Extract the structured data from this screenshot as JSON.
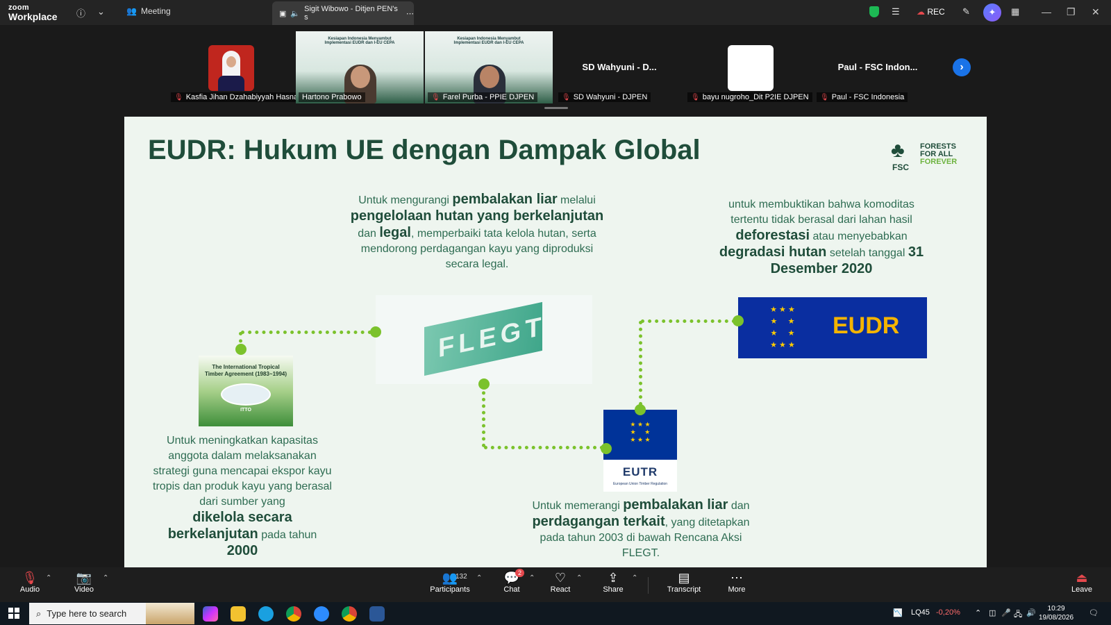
{
  "app": {
    "brand_top": "zoom",
    "brand_bottom": "Workplace",
    "meeting_label": "Meeting",
    "speaker_tab": "Sigit Wibowo - Ditjen PEN's s",
    "rec_label": "REC"
  },
  "participants": [
    {
      "name": "Kasfia Jihan Dzahabiyyah Hasna'"
    },
    {
      "name": "Hartono Prabowo"
    },
    {
      "name": "Farel Purba - PPIE DJPEN"
    },
    {
      "name": "SD Wahyuni - DJPEN",
      "display": "SD Wahyuni - D..."
    },
    {
      "name": "bayu nugroho_Dit P2IE DJPEN"
    },
    {
      "name": "Paul - FSC Indonesia",
      "display": "Paul - FSC Indon..."
    }
  ],
  "video_banner": "Kesiapan Indonesia Menyambut Implementasi EUDR dan I-EU CEPA",
  "slide": {
    "title": "EUDR: Hukum UE dengan Dampak Global",
    "fsc_label": "FSC",
    "fsc_tag_1": "FORESTS",
    "fsc_tag_2": "FOR ALL",
    "fsc_tag_3": "FOREVER",
    "flegt": {
      "t1": "Untuk mengurangi ",
      "b1": "pembalakan liar",
      "t2": " melalui",
      "b2": "pengelolaan hutan yang berkelanjutan",
      "t3": "dan ",
      "b3": "legal",
      "t4": ", memperbaiki tata kelola hutan, serta mendorong perdagangan kayu yang diproduksi secara legal.",
      "word": "FLEGT"
    },
    "eudr": {
      "t1": "untuk membuktikan bahwa komoditas tertentu tidak berasal dari lahan hasil",
      "b1": "deforestasi",
      "t2": " atau menyebabkan",
      "b2": "degradasi hutan",
      "t3": " setelah tanggal ",
      "b3": "31 Desember 2020",
      "label": "EUDR"
    },
    "itto": {
      "t1": "Untuk meningkatkan kapasitas anggota dalam melaksanakan strategi guna mencapai ekspor kayu tropis dan produk kayu yang berasal dari sumber yang",
      "b1": "dikelola secara berkelanjutan",
      "t2": " pada tahun ",
      "b2": "2000",
      "cover_title": "The International Tropical Timber Agreement",
      "cover_years": "(1983~1994)",
      "cover_logo": "ITTO"
    },
    "eutr": {
      "t1": "Untuk memerangi ",
      "b1": "pembalakan liar",
      "t2": " dan",
      "b2": "perdagangan terkait",
      "t3": ", yang ditetapkan pada tahun 2003 di bawah Rencana Aksi FLEGT.",
      "label": "EUTR",
      "sub": "European Union Timber Regulation"
    }
  },
  "toolbar": {
    "audio": "Audio",
    "video": "Video",
    "participants": "Participants",
    "participants_count": "132",
    "chat": "Chat",
    "chat_badge": "2",
    "react": "React",
    "share": "Share",
    "transcript": "Transcript",
    "more": "More",
    "leave": "Leave"
  },
  "taskbar": {
    "search_placeholder": "Type here to search",
    "ticker": "LQ45",
    "ticker_change": "-0,20%",
    "time": "10:29",
    "date": "19/08/2026"
  },
  "colors": {
    "accent_green": "#7bc22c",
    "slide_bg": "#eef5ef",
    "title_green": "#1f4d3a",
    "active_tile": "#1fd27a",
    "eu_blue": "#003399"
  }
}
